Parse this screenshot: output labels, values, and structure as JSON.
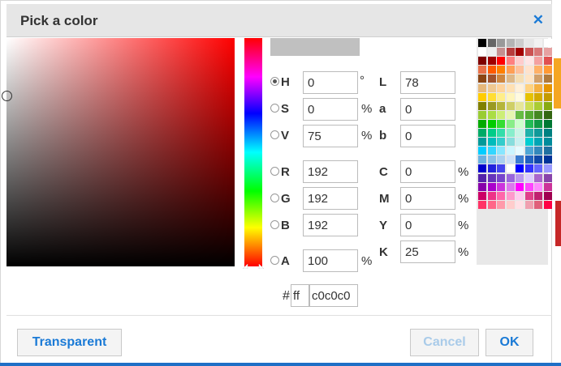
{
  "dialog": {
    "title": "Pick a color",
    "close_icon": "close-icon"
  },
  "current_color": "#c0c0c0",
  "hue_marker_position": 1.0,
  "sv_marker": {
    "saturation": 0,
    "value": 0.75
  },
  "hsv": {
    "h": {
      "label": "H",
      "value": "0",
      "unit": "°",
      "checked": true
    },
    "s": {
      "label": "S",
      "value": "0",
      "unit": "%"
    },
    "v": {
      "label": "V",
      "value": "75",
      "unit": "%"
    }
  },
  "rgb": {
    "r": {
      "label": "R",
      "value": "192"
    },
    "g": {
      "label": "G",
      "value": "192"
    },
    "b": {
      "label": "B",
      "value": "192"
    }
  },
  "alpha": {
    "label": "A",
    "value": "100",
    "unit": "%"
  },
  "lab": {
    "l": {
      "label": "L",
      "value": "78"
    },
    "a": {
      "label": "a",
      "value": "0"
    },
    "b": {
      "label": "b",
      "value": "0"
    }
  },
  "cmyk": {
    "c": {
      "label": "C",
      "value": "0",
      "unit": "%"
    },
    "m": {
      "label": "M",
      "value": "0",
      "unit": "%"
    },
    "y": {
      "label": "Y",
      "value": "0",
      "unit": "%"
    },
    "k": {
      "label": "K",
      "value": "25",
      "unit": "%"
    }
  },
  "hex": {
    "hash": "#",
    "alpha_value": "ff",
    "color_value": "c0c0c0"
  },
  "buttons": {
    "transparent": "Transparent",
    "cancel": "Cancel",
    "ok": "OK"
  },
  "colors": {
    "accent": "#1a7ad6",
    "cancel_disabled": "#a9cbe9"
  },
  "palette": [
    [
      "#000000",
      "#666666",
      "#999999",
      "#b3b3b3",
      "#cccccc",
      "#e6e6e6",
      "#f2f2f2",
      "#ffffff"
    ],
    [
      "#ffffff",
      "#eeeeee",
      "#c58f8f",
      "#b83b3b",
      "#a30000",
      "#cc5252",
      "#d97777",
      "#e6a1a1"
    ],
    [
      "#7f0000",
      "#a00000",
      "#ff0000",
      "#ff8080",
      "#ffcccc",
      "#ffe5e5",
      "#f4a0a0",
      "#e05050"
    ],
    [
      "#e97048",
      "#ff5a00",
      "#ff7f00",
      "#ff9f55",
      "#ffc09a",
      "#ffe2cc",
      "#ffb066",
      "#ff9933"
    ],
    [
      "#8b4513",
      "#a0522d",
      "#cd853f",
      "#deb887",
      "#f5deb3",
      "#ffe4c4",
      "#d2a06a",
      "#b07a3b"
    ],
    [
      "#e6b87a",
      "#f0c890",
      "#ffd39b",
      "#ffe0b3",
      "#fff0d9",
      "#ffd27f",
      "#f5b041",
      "#e59400"
    ],
    [
      "#ffcc00",
      "#ffdd33",
      "#ffee88",
      "#fff5bb",
      "#fffae0",
      "#e6c200",
      "#d4aa00",
      "#c49a00"
    ],
    [
      "#808000",
      "#9a9a20",
      "#b5b53a",
      "#cfcf66",
      "#e6e699",
      "#ccdd55",
      "#aacc33",
      "#88aa11"
    ],
    [
      "#99cc33",
      "#aadd44",
      "#ccee77",
      "#e6f5b0",
      "#66bb44",
      "#55aa33",
      "#448822",
      "#336611"
    ],
    [
      "#00aa00",
      "#00cc00",
      "#33dd33",
      "#88ee88",
      "#ccffcc",
      "#22bb55",
      "#119944",
      "#007733"
    ],
    [
      "#00aa66",
      "#00cc88",
      "#33ddaa",
      "#88eecc",
      "#c8f5e6",
      "#20b2aa",
      "#119999",
      "#008080"
    ],
    [
      "#009999",
      "#00bbbb",
      "#33cccc",
      "#88dddd",
      "#c8f0f0",
      "#00ced1",
      "#00a5b5",
      "#008b9b"
    ],
    [
      "#00ccff",
      "#33d6ff",
      "#88e6ff",
      "#ccf5ff",
      "#e6faff",
      "#4da6d6",
      "#3388bb",
      "#1f6fa0"
    ],
    [
      "#6ab0e0",
      "#88c0e8",
      "#aad0f0",
      "#cce0f8",
      "#3b7bd0",
      "#2060c0",
      "#1048a8",
      "#003399"
    ],
    [
      "#0000cc",
      "#2222dd",
      "#4444ee",
      "#ffffff",
      "#0000ff",
      "#3333ff",
      "#6666ff",
      "#9999ff"
    ],
    [
      "#5522aa",
      "#6633bb",
      "#7744cc",
      "#9966dd",
      "#bb99ee",
      "#ddccff",
      "#aa66cc",
      "#8844aa"
    ],
    [
      "#8800aa",
      "#aa00cc",
      "#cc33dd",
      "#dd77ee",
      "#ff00ff",
      "#ff44ff",
      "#ff88ff",
      "#cc3399"
    ],
    [
      "#cc0066",
      "#ee3388",
      "#ff66aa",
      "#ff99cc",
      "#ffccee",
      "#e0408a",
      "#c02070",
      "#a00050"
    ],
    [
      "#ff3366",
      "#ff6688",
      "#ff99aa",
      "#ffcccc",
      "#ffe0e6",
      "#f0a0b0",
      "#e0607a",
      "#ff0044"
    ]
  ]
}
